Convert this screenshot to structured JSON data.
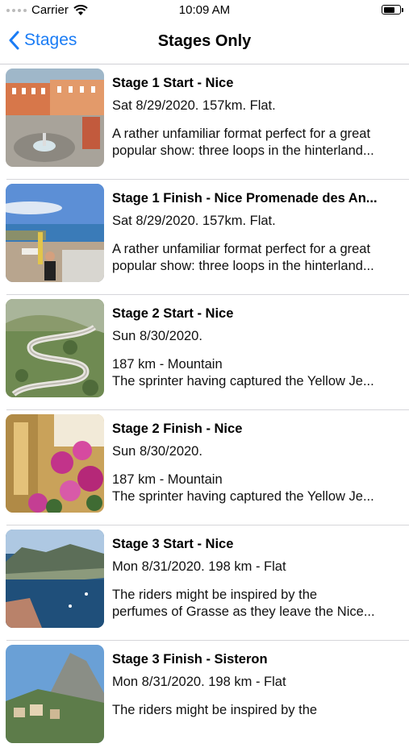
{
  "status_bar": {
    "carrier": "Carrier",
    "time": "10:09 AM",
    "battery_level": 0.75
  },
  "nav": {
    "back_label": "Stages",
    "title": "Stages Only"
  },
  "stages": [
    {
      "title": "Stage 1 Start - Nice",
      "date": "Sat 8/29/2020.  157km. Flat.",
      "line1": "A rather unfamiliar format perfect for a great",
      "line2": "popular show: three loops in the hinterland..."
    },
    {
      "title": "Stage 1 Finish - Nice Promenade des An...",
      "date": "Sat 8/29/2020. 157km. Flat.",
      "line1": "A rather unfamiliar format perfect for a great",
      "line2": "popular show: three loops in the hinterland..."
    },
    {
      "title": "Stage 2 Start - Nice",
      "date": "Sun 8/30/2020.",
      "line1": "187 km - Mountain",
      "line2": "The sprinter having captured the Yellow Je..."
    },
    {
      "title": "Stage 2 Finish - Nice",
      "date": "Sun 8/30/2020.",
      "line1": "187 km - Mountain",
      "line2": "The sprinter having captured the Yellow Je..."
    },
    {
      "title": "Stage 3 Start - Nice",
      "date": "Mon 8/31/2020. 198 km - Flat",
      "line1": "The riders might be inspired by the",
      "line2": "perfumes of Grasse as they leave the Nice..."
    },
    {
      "title": "Stage 3 Finish - Sisteron",
      "date": "Mon 8/31/2020. 198 km - Flat",
      "line1": "The riders might be inspired by the",
      "line2": ""
    }
  ]
}
